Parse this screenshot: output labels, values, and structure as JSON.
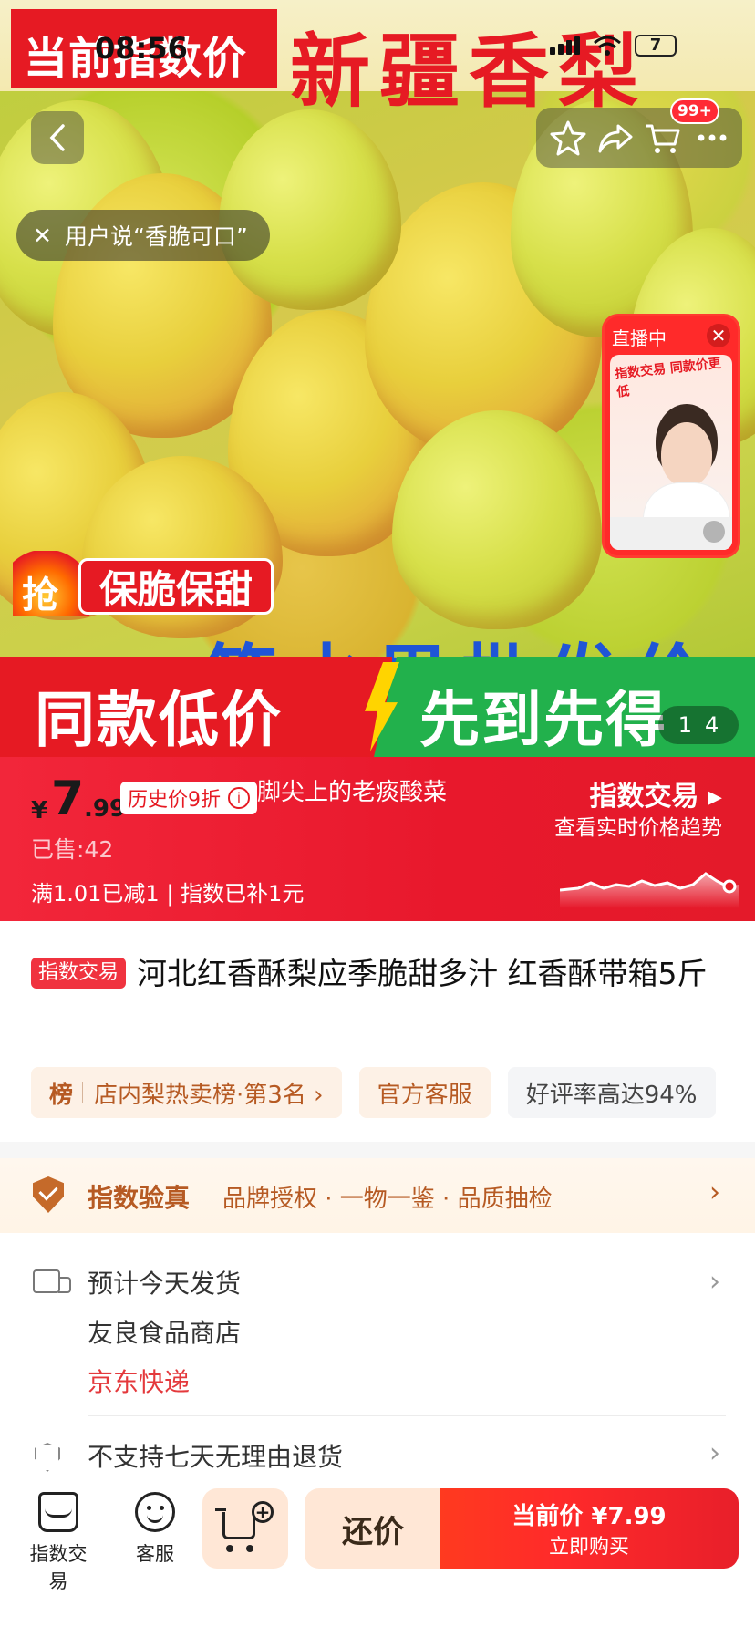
{
  "status_bar": {
    "time": "08:56",
    "battery": "7"
  },
  "hero": {
    "corner_label": "当前指数价",
    "title": "新疆香梨",
    "title_prefix": "",
    "cart_badge": "99+",
    "user_says": "用户说“香脆可口”",
    "live": {
      "tag": "直播中",
      "sub": "指数交易 同款价更低"
    },
    "qiang": "抢",
    "crisp_sweet": "保脆保甜",
    "blue_text": "一箱水果批发价",
    "promo_left": "同款低价",
    "promo_right": "先到先得",
    "page_current": "1",
    "page_total": "4"
  },
  "price": {
    "currency": "¥",
    "integer": "7",
    "decimal": ".99",
    "history_tag": "历史价9折",
    "overlay_text": "脚尖上的老痰酸菜",
    "sold": "已售:42",
    "discount": "满1.01已减1 | 指数已补1元",
    "index_title": "指数交易 ▸",
    "index_sub": "查看实时价格趋势"
  },
  "product": {
    "tag": "指数交易",
    "title": "河北红香酥梨应季脆甜多汁 红香酥带箱5斤"
  },
  "chips": {
    "rank_icon": "榜",
    "rank_text": "店内梨热卖榜·第3名 ›",
    "service": "官方客服",
    "rating": "好评率高达94%"
  },
  "verify": {
    "title": "指数验真",
    "desc": "品牌授权 · 一物一鉴 · 品质抽检"
  },
  "shipping": {
    "estimate": "预计今天发货",
    "store": "友良食品商店",
    "courier": "京东快递"
  },
  "returns": {
    "text": "不支持七天无理由退货"
  },
  "bottom_bar": {
    "store_label": "指数交易",
    "service_label": "客服",
    "bargain": "还价",
    "buy_line1": "当前价 ¥7.99",
    "buy_line2": "立即购买"
  },
  "icons": [
    "back-arrow-icon",
    "star-icon",
    "share-icon",
    "cart-icon",
    "more-icon",
    "close-icon",
    "info-icon",
    "truck-icon",
    "shield-icon",
    "chevron-right-icon",
    "store-icon",
    "customer-service-icon",
    "add-cart-icon"
  ],
  "colors": {
    "brand_red": "#e61a23",
    "accent_orange": "#b65a23",
    "green": "#22b14c",
    "blue": "#1f55d6"
  }
}
